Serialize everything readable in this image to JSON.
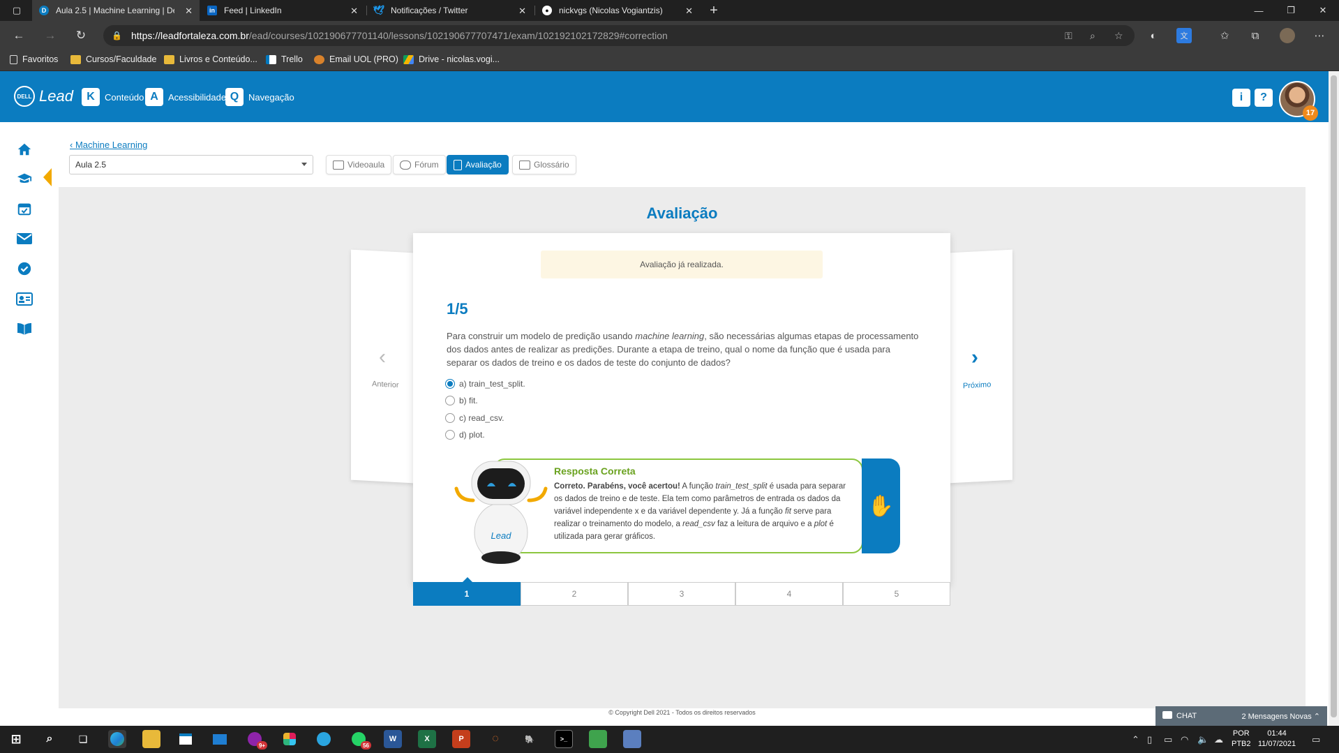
{
  "browser": {
    "tabs": [
      {
        "title": "Aula 2.5 | Machine Learning | De",
        "favicon": "dell-icon",
        "active": true
      },
      {
        "title": "Feed | LinkedIn",
        "favicon": "linkedin-icon",
        "active": false
      },
      {
        "title": "Notificações / Twitter",
        "favicon": "twitter-icon",
        "active": false
      },
      {
        "title": "nickvgs (Nicolas Vogiantzis)",
        "favicon": "github-icon",
        "active": false
      }
    ],
    "url_host": "https://leadfortaleza.com.br",
    "url_path": "/ead/courses/102190677701140/lessons/102190677707471/exam/102192102172829#correction",
    "bookmarks": [
      {
        "label": "Favoritos",
        "icon": "page-icon"
      },
      {
        "label": "Cursos/Faculdade",
        "icon": "folder-icon"
      },
      {
        "label": "Livros e Conteúdo...",
        "icon": "folder-icon"
      },
      {
        "label": "Trello",
        "icon": "trello-icon"
      },
      {
        "label": "Email UOL (PRO)",
        "icon": "uol-icon"
      },
      {
        "label": "Drive - nicolas.vogi...",
        "icon": "drive-icon"
      }
    ]
  },
  "header": {
    "logo_text": "Lead",
    "nav": [
      {
        "key": "K",
        "label": "Conteúdo"
      },
      {
        "key": "A",
        "label": "Acessibilidade"
      },
      {
        "key": "Q",
        "label": "Navegação"
      }
    ],
    "info_label": "i",
    "help_label": "?",
    "notification_count": "17"
  },
  "breadcrumb": {
    "back_label": "Machine Learning"
  },
  "lesson_select": {
    "value": "Aula 2.5"
  },
  "content_tabs": [
    {
      "label": "Videoaula",
      "active": false
    },
    {
      "label": "Fórum",
      "active": false
    },
    {
      "label": "Avaliação",
      "active": true
    },
    {
      "label": "Glossário",
      "active": false
    }
  ],
  "page_title": "Avaliação",
  "exam": {
    "notice": "Avaliação já realizada.",
    "question_number": "1/5",
    "question_part1": "Para construir um modelo de predição usando ",
    "question_em": "machine learning",
    "question_part2": ", são necessárias algumas etapas de processamento dos dados antes de realizar as predições. Durante a etapa de treino, qual o nome da função que é usada para separar os dados de treino e os dados de teste do conjunto de dados?",
    "options": [
      {
        "label": "a) train_test_split.",
        "selected": true
      },
      {
        "label": "b) fit.",
        "selected": false
      },
      {
        "label": "c) read_csv.",
        "selected": false
      },
      {
        "label": "d) plot.",
        "selected": false
      }
    ],
    "prev_label": "Anterior",
    "next_label": "Próximo",
    "feedback": {
      "title": "Resposta Correta",
      "bold": "Correto. Parabéns, você acertou!",
      "t1": " A função ",
      "e1": "train_test_split",
      "t2": " é usada para separar os dados de treino e de teste. Ela tem como parâmetros de entrada os dados da variável independente x e da variável dependente y. Já a função ",
      "e2": "fit",
      "t3": " serve para realizar o treinamento do modelo, a ",
      "e3": "read_csv",
      "t4": " faz a leitura de arquivo e a ",
      "e4": "plot",
      "t5": " é utilizada para gerar gráficos.",
      "robot_logo": "Lead"
    },
    "question_tabs": [
      "1",
      "2",
      "3",
      "4",
      "5"
    ],
    "active_question": "1"
  },
  "footer": "© Copyright Dell 2021 - Todos os direitos reservados",
  "chat": {
    "label": "CHAT",
    "messages": "2 Mensagens Novas"
  },
  "taskbar": {
    "badge_chrome": "9+",
    "badge_whatsapp": "56",
    "lang_top": "POR",
    "lang_bottom": "PTB2",
    "time": "01:44",
    "date": "11/07/2021"
  },
  "colors": {
    "brand": "#0b7cc0",
    "accent": "#f2a900",
    "correct": "#6aa21f"
  }
}
